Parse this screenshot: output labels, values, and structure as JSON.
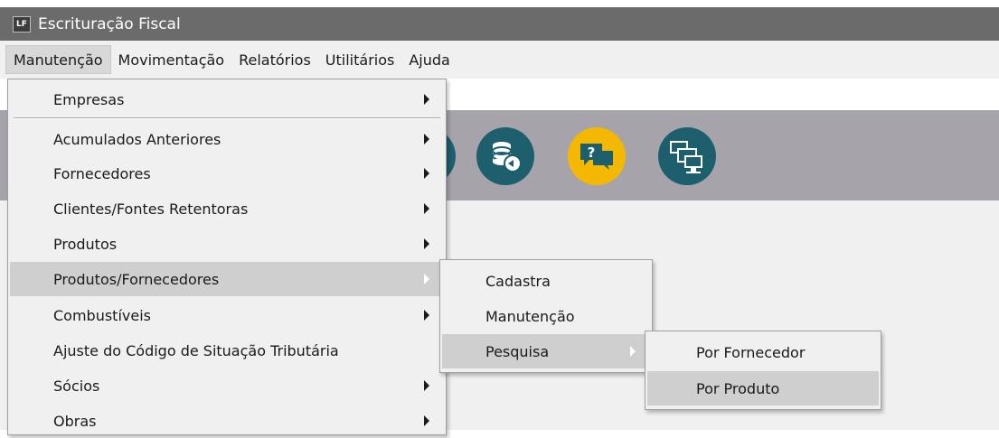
{
  "window": {
    "title": "Escrituração Fiscal",
    "icon_label": "LF"
  },
  "menubar": {
    "items": [
      "Manutenção",
      "Movimentação",
      "Relatórios",
      "Utilitários",
      "Ajuda"
    ]
  },
  "menu_manutencao": {
    "items": [
      "Empresas",
      "Acumulados Anteriores",
      "Fornecedores",
      "Clientes/Fontes Retentoras",
      "Produtos",
      "Produtos/Fornecedores",
      "Combustíveis",
      "Ajuste do Código de Situação Tributária",
      "Sócios",
      "Obras"
    ]
  },
  "submenu_produtos_fornecedores": {
    "items": [
      "Cadastra",
      "Manutenção",
      "Pesquisa"
    ]
  },
  "submenu_pesquisa": {
    "items": [
      "Por Fornecedor",
      "Por Produto"
    ]
  },
  "toolbar": {
    "icons": [
      "database-restore-icon",
      "help-chat-icon",
      "network-monitors-icon"
    ],
    "help_glyph": "?"
  },
  "colors": {
    "titlebar": "#6b6b6b",
    "toolbar": "#a7a3aa",
    "icon_teal": "#1e5f6e",
    "icon_yellow": "#f5b800",
    "highlight": "#cfcfcf"
  }
}
